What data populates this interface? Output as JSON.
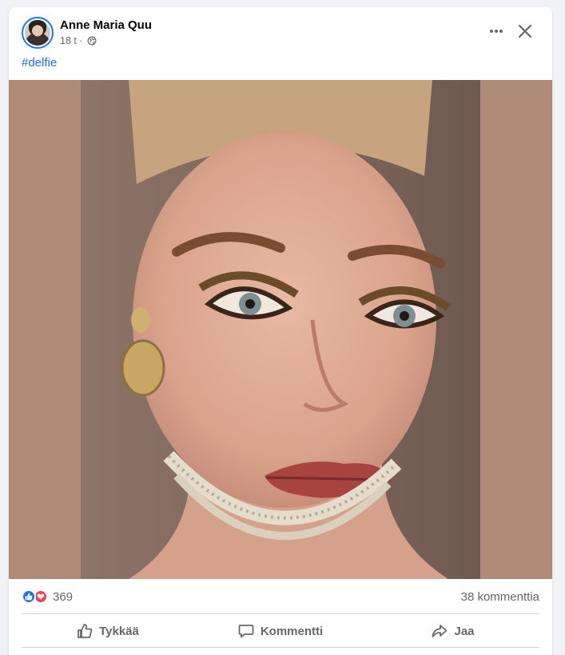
{
  "post": {
    "author": "Anne Maria Quu",
    "time": "18 t",
    "separator": "·",
    "privacy_icon": "globe-icon",
    "hashtag": "#delfie"
  },
  "stats": {
    "reaction_count": "369",
    "reaction_icons": [
      "like-icon",
      "love-icon"
    ],
    "comments": "38 kommenttia"
  },
  "actions": {
    "like_label": "Tykkää",
    "comment_label": "Kommentti",
    "share_label": "Jaa"
  },
  "colors": {
    "link": "#216fdb",
    "like": "#1b74e4",
    "love": "#f33e58",
    "photo_background": "#b08a76"
  }
}
